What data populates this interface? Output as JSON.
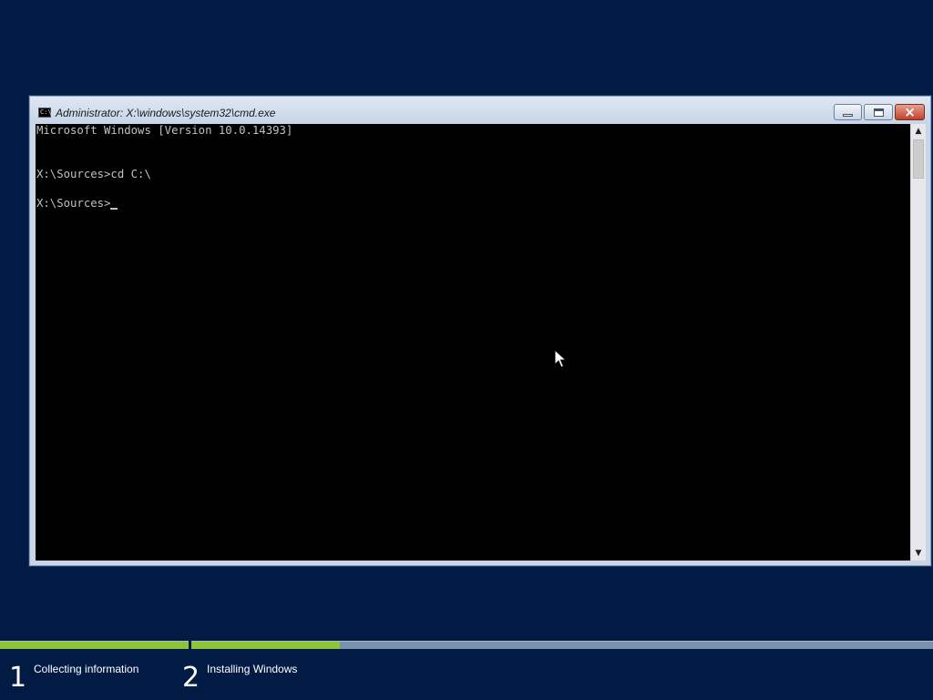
{
  "window": {
    "title": "Administrator: X:\\windows\\system32\\cmd.exe",
    "icon": "cmd-icon",
    "icon_text": "C:\\"
  },
  "console": {
    "lines": [
      "Microsoft Windows [Version 10.0.14393]",
      "X:\\Sources>cd C:\\",
      "X:\\Sources>"
    ]
  },
  "setup": {
    "steps": [
      {
        "number": "1",
        "label": "Collecting information",
        "progress": 1.0
      },
      {
        "number": "2",
        "label": "Installing Windows",
        "progress": 0.2
      }
    ]
  },
  "colors": {
    "background": "#021b45",
    "progress_fill": "#8cc43a",
    "progress_track": "#7a91ab",
    "console_bg": "#000000",
    "console_text": "#c0c0c0"
  }
}
